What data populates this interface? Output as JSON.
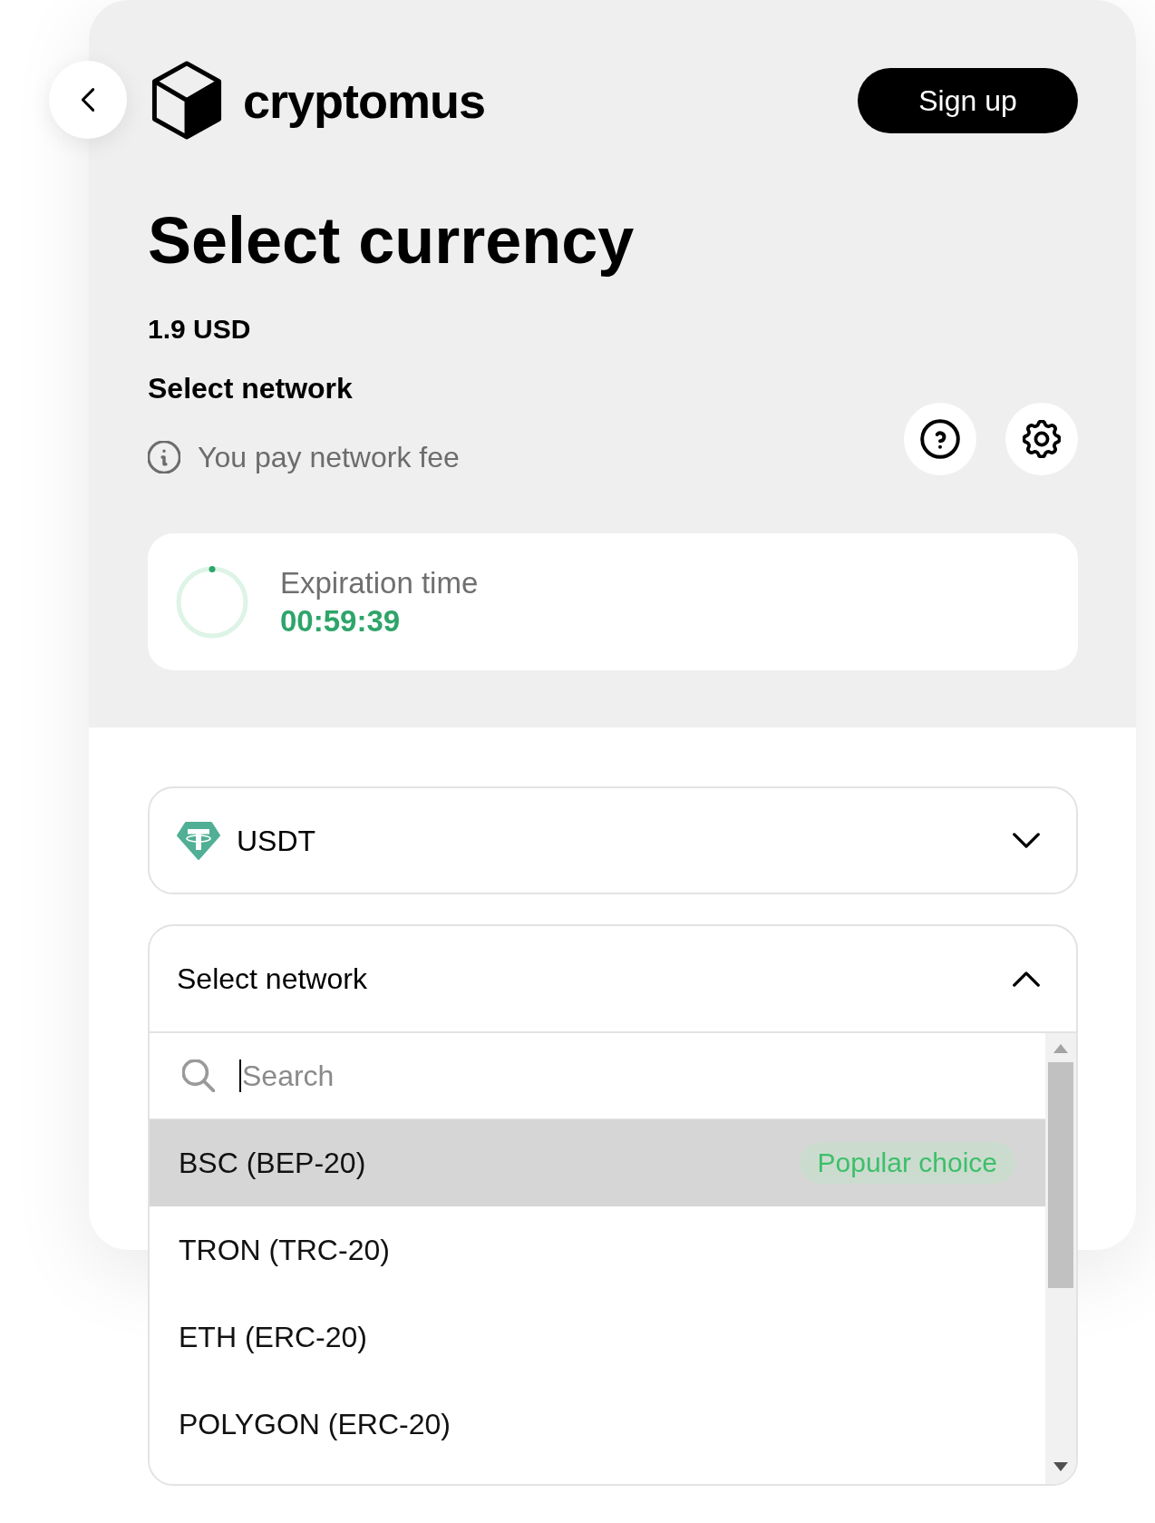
{
  "header": {
    "logo": "cryptomus",
    "sign_up_button": "Sign up"
  },
  "title": "Select currency",
  "amount": "1.9 USD",
  "network_label": "Select network",
  "fee_note": "You pay network fee",
  "expiration": {
    "label": "Expiration time",
    "time": "00:59:39"
  },
  "currency_select": {
    "value": "USDT",
    "expanded": false
  },
  "network_select": {
    "label": "Select network",
    "expanded": true,
    "search": {
      "placeholder": "Search",
      "focused": true
    },
    "options": [
      {
        "label": "BSC (BEP-20)",
        "selected": true,
        "badge": "Popular choice"
      },
      {
        "label": "TRON (TRC-20)",
        "selected": false
      },
      {
        "label": "ETH (ERC-20)",
        "selected": false
      },
      {
        "label": "POLYGON (ERC-20)",
        "selected": false
      }
    ]
  }
}
